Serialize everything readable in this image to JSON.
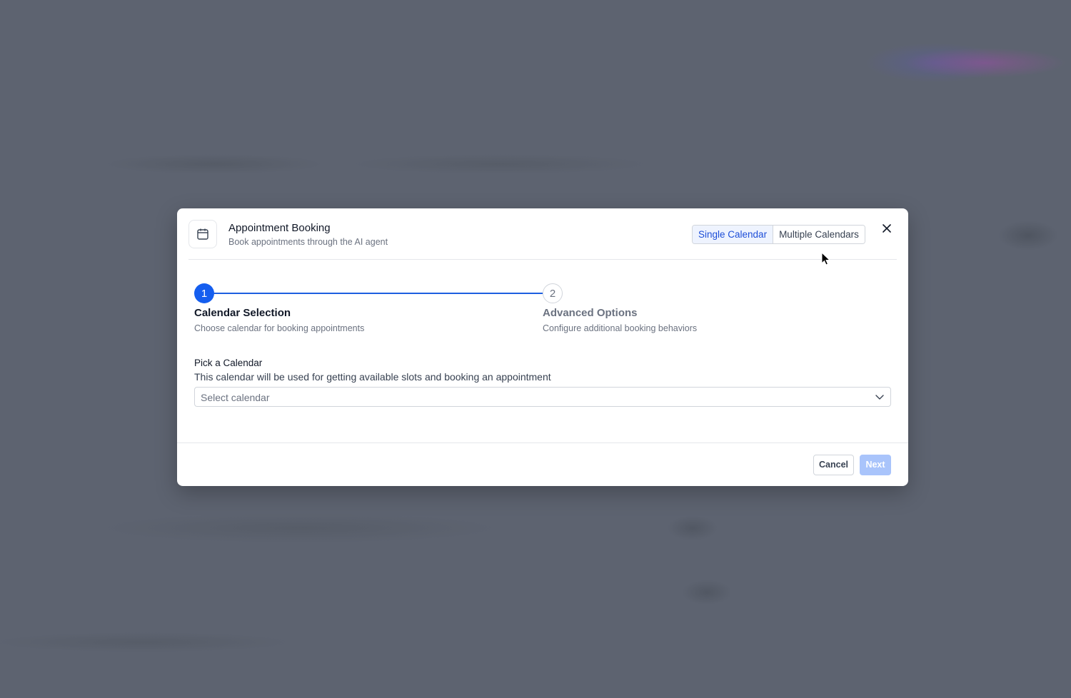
{
  "header": {
    "icon": "calendar-icon",
    "title": "Appointment Booking",
    "subtitle": "Book appointments through the AI agent",
    "mode_toggle": {
      "options": [
        "Single Calendar",
        "Multiple Calendars"
      ],
      "selected": "Single Calendar"
    },
    "close_icon": "close-icon"
  },
  "stepper": {
    "steps": [
      {
        "number": "1",
        "title": "Calendar Selection",
        "description": "Choose calendar for booking appointments",
        "active": true
      },
      {
        "number": "2",
        "title": "Advanced Options",
        "description": "Configure additional booking behaviors",
        "active": false
      }
    ]
  },
  "calendar_field": {
    "label": "Pick a Calendar",
    "help": "This calendar will be used for getting available slots and booking an appointment",
    "placeholder": "Select calendar"
  },
  "footer": {
    "cancel_label": "Cancel",
    "next_label": "Next"
  },
  "colors": {
    "accent": "#155eef",
    "disabled_button": "#a9c4fb",
    "overlay": "#5d6370"
  }
}
